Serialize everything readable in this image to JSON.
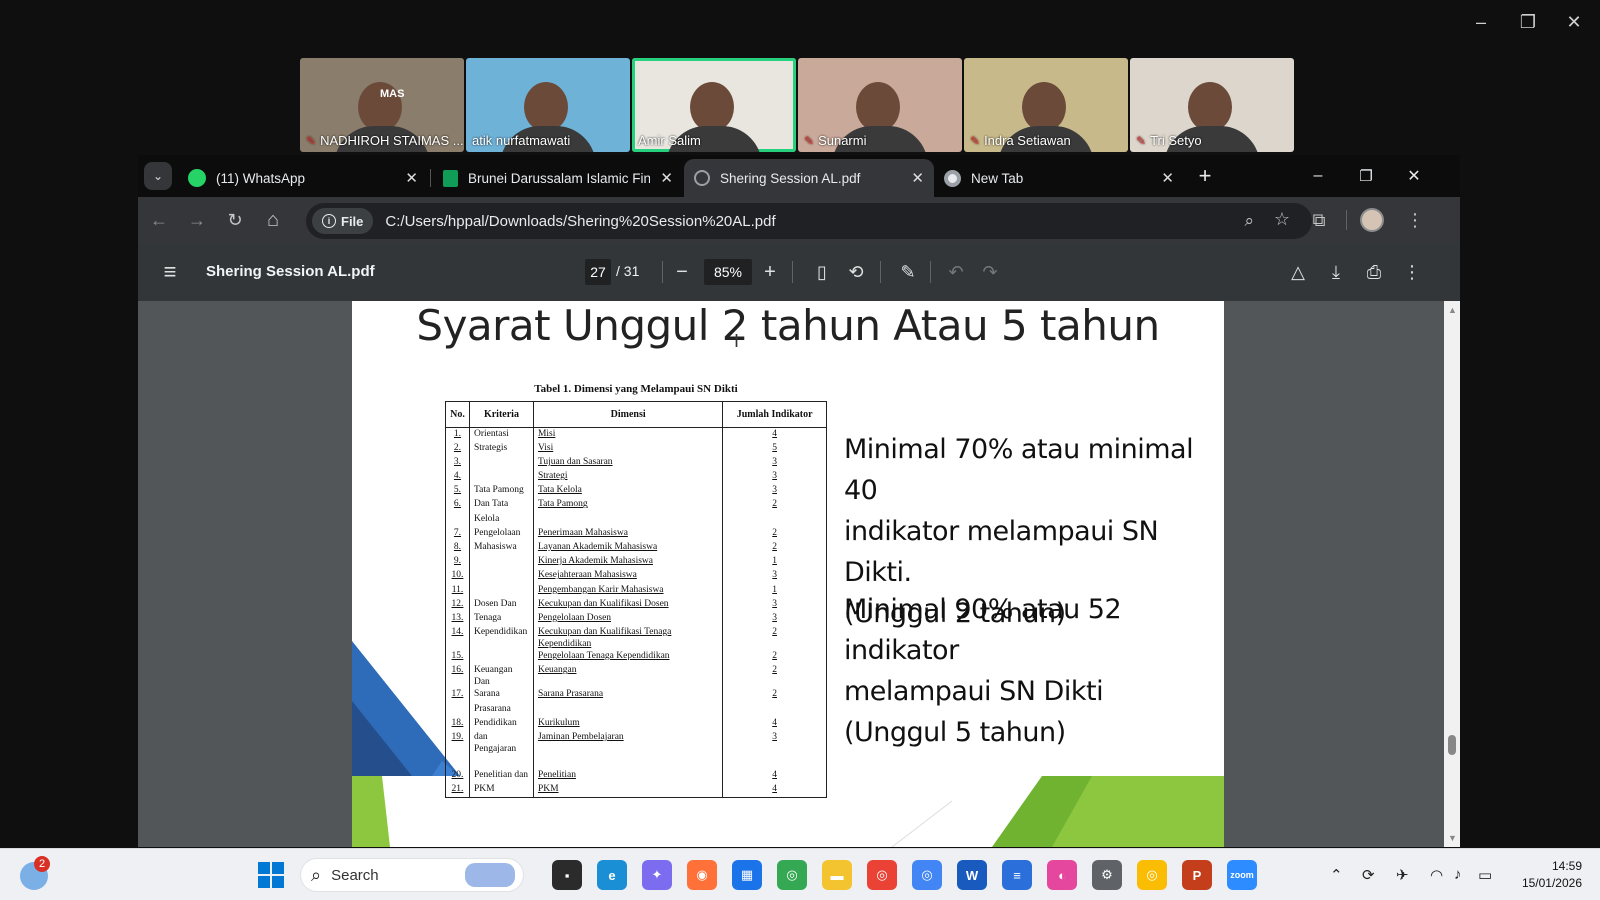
{
  "zoom_window": {
    "minimize": "–",
    "restore": "❐",
    "close": "✕"
  },
  "participants": [
    {
      "name": "NADHIROH STAIMAS ...",
      "muted": true,
      "active": false,
      "bg": "#8a7d6b",
      "sign": "MAS"
    },
    {
      "name": "atik nurfatmawati",
      "muted": false,
      "active": false,
      "bg": "#6fb2d8"
    },
    {
      "name": "Amir Salim",
      "muted": false,
      "active": true,
      "bg": "#e9e6df"
    },
    {
      "name": "Sunarmi",
      "muted": true,
      "active": false,
      "bg": "#c9a99a"
    },
    {
      "name": "Indra Setiawan",
      "muted": true,
      "active": false,
      "bg": "#c8b98a"
    },
    {
      "name": "Tri Setyo",
      "muted": true,
      "active": false,
      "bg": "#dcd6cc"
    }
  ],
  "browser": {
    "tabs": [
      {
        "title": "(11) WhatsApp",
        "icon": "whatsapp-icon",
        "close": "✕"
      },
      {
        "title": "Brunei Darussalam Islamic Finar",
        "icon": "sheets-icon",
        "close": "✕"
      },
      {
        "title": "Shering Session AL.pdf",
        "icon": "globe-icon",
        "close": "✕"
      },
      {
        "title": "New Tab",
        "icon": "chrome-icon",
        "close": "✕"
      }
    ],
    "new_tab": "+",
    "window": {
      "minimize": "–",
      "restore": "❐",
      "close": "✕"
    },
    "nav": {
      "back": "←",
      "forward": "→",
      "reload": "↻",
      "home": "⌂"
    },
    "chip_label": "File",
    "url": "C:/Users/hppal/Downloads/Shering%20Session%20AL.pdf"
  },
  "pdf": {
    "menu": "≡",
    "title": "Shering Session AL.pdf",
    "page_current": "27",
    "page_total": "/ 31",
    "zoom": "85%",
    "minus": "−",
    "plus": "+"
  },
  "slide": {
    "title": "Syarat Unggul 2 tahun Atau 5 tahun",
    "table_caption": "Tabel 1. Dimensi yang Melampaui SN Dikti",
    "headers": [
      "No.",
      "Kriteria",
      "Dimensi",
      "Jumlah Indikator"
    ],
    "rows": [
      [
        "1.",
        "Orientasi",
        "Misi",
        "4"
      ],
      [
        "2.",
        "Strategis",
        "Visi",
        "5"
      ],
      [
        "3.",
        "",
        "Tujuan dan Sasaran",
        "3"
      ],
      [
        "4.",
        "",
        "Strategi",
        "3"
      ],
      [
        "5.",
        "Tata Pamong",
        "Tata Kelola",
        "3"
      ],
      [
        "6.",
        "Dan Tata",
        "Tata Pamong",
        "2"
      ],
      [
        "",
        "Kelola",
        "",
        ""
      ],
      [
        "7.",
        "Pengelolaan",
        "Penerimaan Mahasiswa",
        "2"
      ],
      [
        "8.",
        "Mahasiswa",
        "Layanan Akademik Mahasiswa",
        "2"
      ],
      [
        "9.",
        "",
        "Kinerja Akademik Mahasiswa",
        "1"
      ],
      [
        "10.",
        "",
        "Kesejahteraan Mahasiswa",
        "3"
      ],
      [
        "11.",
        "",
        "Pengembangan Karir Mahasiswa",
        "1"
      ],
      [
        "12.",
        "Dosen Dan",
        "Kecukupan dan Kualifikasi Dosen",
        "3"
      ],
      [
        "13.",
        "Tenaga",
        "Pengelolaan Dosen",
        "3"
      ],
      [
        "14.",
        "Kependidikan",
        "Kecukupan dan Kualifikasi Tenaga Kependidikan",
        "2"
      ],
      [
        "15.",
        "",
        "Pengelolaan Tenaga Kependidikan",
        "2"
      ],
      [
        "16.",
        "Keuangan Dan",
        "Keuangan",
        "2"
      ],
      [
        "17.",
        "Sarana",
        "Sarana Prasarana",
        "2"
      ],
      [
        "",
        "Prasarana",
        "",
        ""
      ],
      [
        "18.",
        "Pendidikan",
        "Kurikulum",
        "4"
      ],
      [
        "19.",
        "dan Pengajaran",
        "Jaminan Pembelajaran",
        "3"
      ],
      [
        "",
        "",
        "",
        ""
      ],
      [
        "20.",
        "Penelitian dan",
        "Penelitian",
        "4"
      ],
      [
        "21.",
        "PKM",
        "PKM",
        "4"
      ]
    ],
    "note1": [
      "Minimal 70% atau minimal 40",
      "indikator melampaui SN Dikti.",
      "(Unggul 2 tahun)"
    ],
    "note2": [
      "Minimal 90% atau 52 indikator",
      "melampaui SN Dikti",
      "(Unggul 5 tahun)"
    ]
  },
  "taskbar": {
    "search_placeholder": "Search",
    "badge": "2",
    "time": "14:59",
    "date": "15/01/2026",
    "apps": [
      {
        "name": "task-view-icon",
        "color": "#2b2b2b",
        "label": "▪"
      },
      {
        "name": "edge-icon",
        "color": "#1b8fd6",
        "label": "e"
      },
      {
        "name": "copilot-icon",
        "color": "#7b6cf0",
        "label": "✦"
      },
      {
        "name": "firefox-icon",
        "color": "#ff7139",
        "label": "◉"
      },
      {
        "name": "store-icon",
        "color": "#1a73e8",
        "label": "▦"
      },
      {
        "name": "chrome-icon",
        "color": "#34a853",
        "label": "◎"
      },
      {
        "name": "file-explorer-icon",
        "color": "#f4c430",
        "label": "▬"
      },
      {
        "name": "chrome-profile-icon",
        "color": "#ea4335",
        "label": "◎"
      },
      {
        "name": "chrome-profile2-icon",
        "color": "#4285f4",
        "label": "◎"
      },
      {
        "name": "word-icon",
        "color": "#185abd",
        "label": "W"
      },
      {
        "name": "notes-icon",
        "color": "#2b6fdb",
        "label": "≡"
      },
      {
        "name": "photos-icon",
        "color": "#e6479e",
        "label": "◐"
      },
      {
        "name": "settings-icon",
        "color": "#5f6368",
        "label": "⚙"
      },
      {
        "name": "chrome-profile3-icon",
        "color": "#fbbc04",
        "label": "◎"
      },
      {
        "name": "powerpoint-icon",
        "color": "#c43e1c",
        "label": "P"
      },
      {
        "name": "zoom-icon",
        "color": "#2d8cff",
        "label": "zoom"
      }
    ]
  }
}
